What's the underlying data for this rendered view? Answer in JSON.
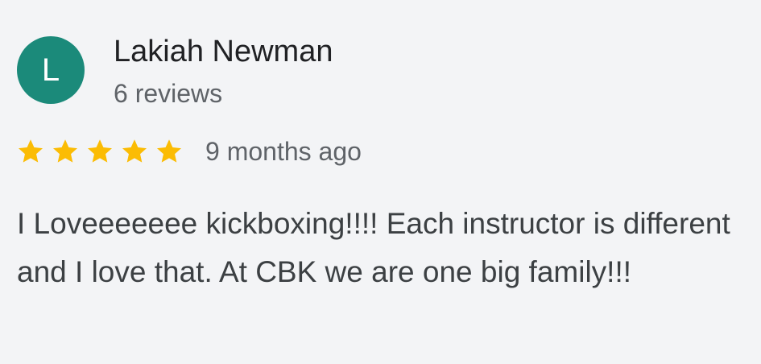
{
  "review": {
    "reviewer": {
      "initial": "L",
      "name": "Lakiah Newman",
      "review_count": "6 reviews",
      "avatar_color": "#1b8a7a"
    },
    "rating": {
      "stars": 5,
      "max_stars": 5,
      "star_color": "#fbbc04",
      "star_icon": "star-icon"
    },
    "time_ago": "9 months ago",
    "text": "I Loveeeeeee kickboxing!!!! Each instructor is different and I love that. At CBK we are one big family!!!"
  }
}
